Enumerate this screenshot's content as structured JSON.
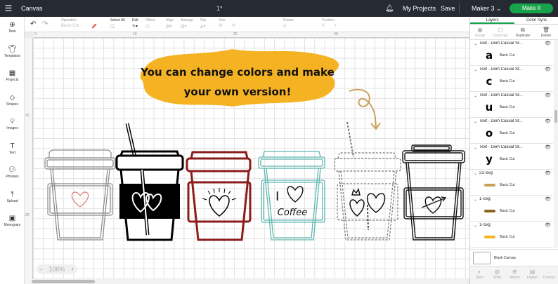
{
  "topbar": {
    "menu_icon": "hamburger-icon",
    "title": "Canvas",
    "doc_name": "1*",
    "bell_icon": "bell-icon",
    "my_projects": "My Projects",
    "save": "Save",
    "machine": "Maker 3",
    "machine_chevron": "⌄",
    "make_it": "Make It",
    "make_it_color": "#16a34a"
  },
  "toolbar": {
    "undo": "↶",
    "redo": "↷",
    "operation_label": "Operation",
    "operation_value": "Basic Cut",
    "select_all": "Select All",
    "edit": "Edit",
    "offset": "Offset",
    "align": "Align",
    "arrange": "Arrange",
    "flip": "Flip",
    "size": "Size",
    "rotate": "Rotate",
    "position": "Position",
    "size_w": "W",
    "size_h": "H",
    "x": "X",
    "y": "Y"
  },
  "sidebar": {
    "items": [
      {
        "label": "New",
        "icon": "plus-icon"
      },
      {
        "label": "Templates",
        "icon": "shirt-icon"
      },
      {
        "label": "Projects",
        "icon": "projects-icon"
      },
      {
        "label": "Shapes",
        "icon": "shapes-icon"
      },
      {
        "label": "Images",
        "icon": "lightbulb-icon"
      },
      {
        "label": "Text",
        "icon": "text-icon"
      },
      {
        "label": "Phrases",
        "icon": "speech-bubble-icon"
      },
      {
        "label": "Upload",
        "icon": "upload-icon"
      },
      {
        "label": "Monogram",
        "icon": "monogram-icon"
      }
    ]
  },
  "ruler": {
    "top": [
      "0",
      "10",
      "20",
      "30"
    ],
    "left": [
      "10",
      "20"
    ]
  },
  "canvas": {
    "banner_line1": "You can change colors and make",
    "banner_line2": "your own version!",
    "cup_text_i": "I",
    "cup_text_coffee": "Coffee",
    "banner_color": "#f5b323",
    "zoom": "100%",
    "zoom_minus": "−",
    "zoom_plus": "+"
  },
  "panel": {
    "tabs": [
      "Layers",
      "Color Sync"
    ],
    "actions": [
      "Group",
      "UnGroup",
      "Duplicate",
      "Delete"
    ],
    "layers": [
      {
        "name": "Text - Dom Casual St...",
        "glyph": "a",
        "op": "Basic Cut"
      },
      {
        "name": "Text - Dom Casual St...",
        "glyph": "c",
        "op": "Basic Cut"
      },
      {
        "name": "Text - Dom Casual St...",
        "glyph": "u",
        "op": "Basic Cut"
      },
      {
        "name": "Text - Dom Casual St...",
        "glyph": "o",
        "op": "Basic Cut"
      },
      {
        "name": "Text - Dom Casual St...",
        "glyph": "y",
        "op": "Basic Cut"
      },
      {
        "name": "21-Svg",
        "glyph": "",
        "op": "Basic Cut",
        "swatch": "#c9a15a"
      },
      {
        "name": "1-Svg",
        "glyph": "",
        "op": "Basic Cut",
        "swatch": "#8a6420"
      },
      {
        "name": "1-Svg",
        "glyph": "",
        "op": "Basic Cut",
        "swatch": "#f5b323"
      }
    ],
    "blank_canvas": "Blank Canvas",
    "bottom": [
      "Slice",
      "Weld",
      "Attach",
      "Flatten",
      "Contour"
    ]
  }
}
